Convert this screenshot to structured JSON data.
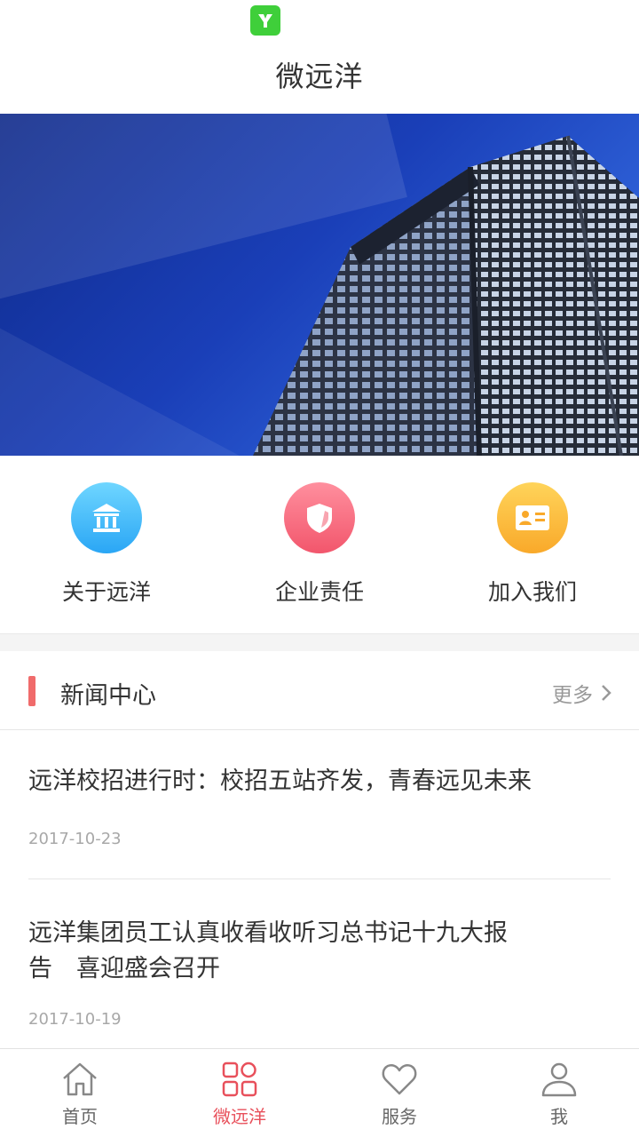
{
  "app": {
    "title": "微远洋"
  },
  "banner": {
    "slide_count": 5,
    "active_index": 0
  },
  "shortcuts": [
    {
      "label": "关于远洋",
      "icon": "bank-icon",
      "color": "#2aa6f5"
    },
    {
      "label": "企业责任",
      "icon": "shield-icon",
      "color": "#f2566c"
    },
    {
      "label": "加入我们",
      "icon": "id-card-icon",
      "color": "#f9a92a"
    }
  ],
  "news": {
    "section_title": "新闻中心",
    "more_label": "更多",
    "accent": "#f06b6b",
    "items": [
      {
        "title": "远洋校招进行时：校招五站齐发，青春远见未来",
        "date": "2017-10-23"
      },
      {
        "title_line1": "远洋集团员工认真收看收听习总书记十九大报",
        "title_line2": "告　喜迎盛会召开",
        "date": "2017-10-19"
      }
    ]
  },
  "tabbar": {
    "active_color": "#e8505b",
    "tabs": [
      {
        "label": "首页",
        "icon": "home-icon",
        "active": false
      },
      {
        "label": "微远洋",
        "icon": "grid-icon",
        "active": true
      },
      {
        "label": "服务",
        "icon": "heart-icon",
        "active": false
      },
      {
        "label": "我",
        "icon": "person-icon",
        "active": false
      }
    ]
  }
}
